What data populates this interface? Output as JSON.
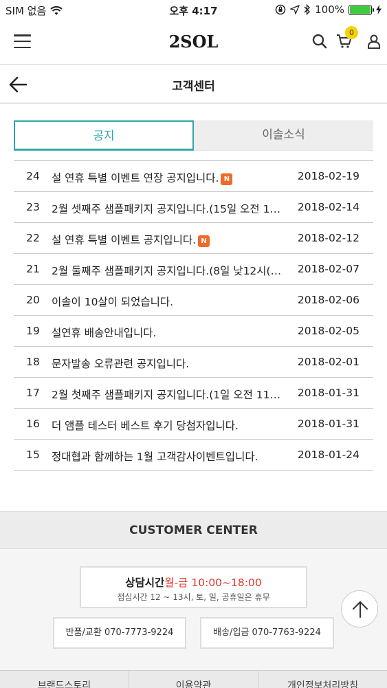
{
  "status_bar": {
    "carrier": "SIM 없음",
    "time": "오후 4:17",
    "battery": "100%"
  },
  "header": {
    "logo": "2SOL",
    "cart_count": "0"
  },
  "subheader": {
    "title": "고객센터"
  },
  "tabs": [
    {
      "label": "공지",
      "active": true
    },
    {
      "label": "이솔소식",
      "active": false
    }
  ],
  "notices": [
    {
      "num": "24",
      "title": "설 연휴 특별 이벤트 연장 공지입니다.",
      "new": true,
      "date": "2018-02-19"
    },
    {
      "num": "23",
      "title": "2월 셋째주 샘플패키지 공지입니다.(15일 오전 1…",
      "new": false,
      "date": "2018-02-14"
    },
    {
      "num": "22",
      "title": "설 연휴 특별 이벤트 공지입니다.",
      "new": true,
      "date": "2018-02-12"
    },
    {
      "num": "21",
      "title": "2월 둘째주 샘플패키지 공지입니다.(8일 낮12시(…",
      "new": false,
      "date": "2018-02-07"
    },
    {
      "num": "20",
      "title": "이솔이 10살이 되었습니다.",
      "new": false,
      "date": "2018-02-06"
    },
    {
      "num": "19",
      "title": "설연휴 배송안내입니다.",
      "new": false,
      "date": "2018-02-05"
    },
    {
      "num": "18",
      "title": "문자발송 오류관련 공지입니다.",
      "new": false,
      "date": "2018-02-01"
    },
    {
      "num": "17",
      "title": "2월 첫째주 샘플패키지 공지입니다.(1일 오전 11…",
      "new": false,
      "date": "2018-01-31"
    },
    {
      "num": "16",
      "title": "더 앰플 테스터 베스트 후기 당첨자입니다.",
      "new": false,
      "date": "2018-01-31"
    },
    {
      "num": "15",
      "title": "정대협과 함께하는 1월 고객감사이벤트입니다.",
      "new": false,
      "date": "2018-01-24"
    }
  ],
  "new_badge": "N",
  "customer_center": {
    "title": "CUSTOMER CENTER",
    "hours_label": "상담시간",
    "hours_time": "월-금 10:00~18:00",
    "hours_note": "점심시간 12 ~ 13시, 토, 일, 공휴일은 휴무",
    "return_label": "반품/교환 070-7773-9224",
    "shipping_label": "배송/입금 070-7763-9224"
  },
  "footer_links": [
    "브랜드스토리",
    "이용약관",
    "개인정보처리방침"
  ],
  "colors": {
    "accent": "#2fa7a7",
    "new_badge": "#f26a2a",
    "cart_badge": "#f7d200",
    "hours_time": "#e0362b"
  }
}
